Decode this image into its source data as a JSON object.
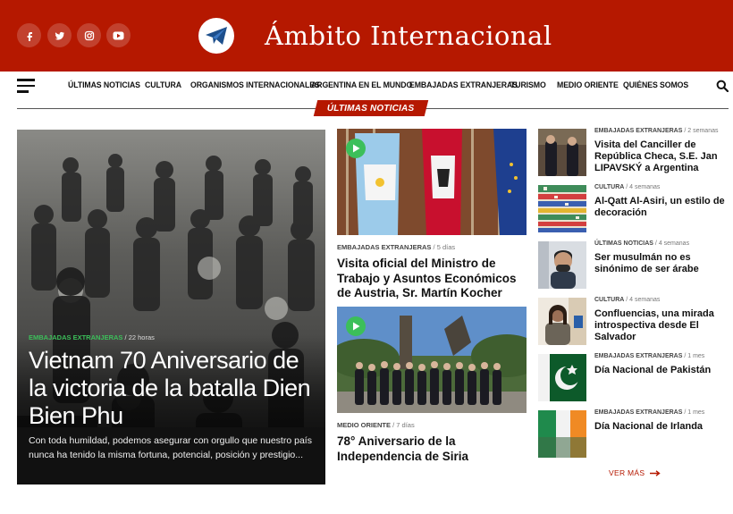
{
  "colors": {
    "brand_red": "#b51800",
    "accent_green": "#3cbf5a",
    "text_dark": "#111111"
  },
  "header": {
    "site_title": "Ámbito Internacional",
    "social_icons": [
      "facebook-icon",
      "twitter-icon",
      "instagram-icon",
      "youtube-icon"
    ],
    "logo_icon": "paper-plane-icon"
  },
  "nav": {
    "menu_icon": "hamburger-icon",
    "items": [
      "ÚLTIMAS NOTICIAS",
      "CULTURA",
      "ORGANISMOS INTERNACIONALES",
      "ARGENTINA EN EL MUNDO",
      "EMBAJADAS EXTRANJERAS",
      "TURISMO",
      "MEDIO ORIENTE",
      "QUIÉNES SOMOS"
    ],
    "search_icon": "search-icon"
  },
  "section_label": "ÚLTIMAS NOTICIAS",
  "feature": {
    "category": "EMBAJADAS EXTRANJERAS",
    "time": "22 horas",
    "title": "Vietnam 70 Aniversario de la victoria de la batalla Dien Bien Phu",
    "excerpt": "Con toda humildad, podemos asegurar con orgullo que nuestro país nunca ha tenido la misma fortuna, potencial, posición y prestigio..."
  },
  "middle": [
    {
      "category": "EMBAJADAS EXTRANJERAS",
      "time": "5 días",
      "title": "Visita oficial del Ministro de Trabajo y Asuntos Económicos de Austria, Sr. Martín Kocher"
    },
    {
      "category": "MEDIO ORIENTE",
      "time": "7 días",
      "title": "78° Aniversario de la Independencia de Siria"
    }
  ],
  "sidebar": [
    {
      "category": "EMBAJADAS EXTRANJERAS",
      "time": "2 semanas",
      "title": "Visita del Canciller de República Checa, S.E. Jan LIPAVSKÝ a Argentina"
    },
    {
      "category": "CULTURA",
      "time": "4 semanas",
      "title": "Al-Qatt Al-Asiri, un estilo de decoración"
    },
    {
      "category": "ÚLTIMAS NOTICIAS",
      "time": "4 semanas",
      "title": "Ser musulmán no es sinónimo de ser árabe"
    },
    {
      "category": "CULTURA",
      "time": "4 semanas",
      "title": "Confluencias, una mirada introspectiva desde El Salvador"
    },
    {
      "category": "EMBAJADAS EXTRANJERAS",
      "time": "1 mes",
      "title": "Día Nacional de Pakistán"
    },
    {
      "category": "EMBAJADAS EXTRANJERAS",
      "time": "1 mes",
      "title": "Día Nacional de Irlanda"
    }
  ],
  "more_link": "VER MÁS"
}
